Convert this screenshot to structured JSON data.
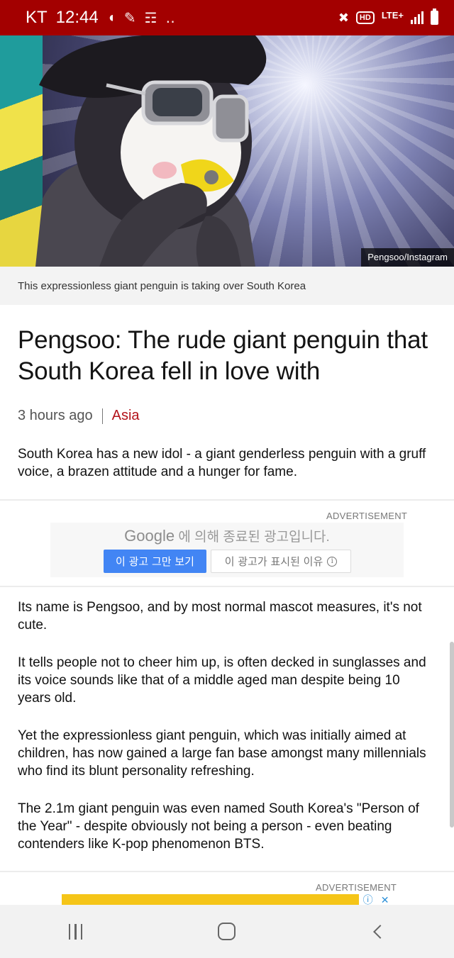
{
  "status_bar": {
    "carrier": "KT",
    "time": "12:44",
    "left_icons": [
      "c-icon",
      "pen-icon",
      "chart-search-icon",
      "more-dots-icon"
    ],
    "hd": "HD",
    "network": "LTE+"
  },
  "hero": {
    "photo_credit": "Pengsoo/Instagram",
    "caption": "This expressionless giant penguin is taking over South Korea"
  },
  "article": {
    "headline": "Pengsoo: The rude giant penguin that South Korea fell in love with",
    "time_ago": "3 hours ago",
    "section": "Asia",
    "summary": "South Korea has a new idol - a giant genderless penguin with a gruff voice, a brazen attitude and a hunger for fame.",
    "paragraphs": [
      "Its name is Pengsoo, and by most normal mascot measures, it's not cute.",
      "It tells people not to cheer him up, is often decked in sunglasses and its voice sounds like that of a middle aged man despite being 10 years old.",
      "Yet the expressionless giant penguin, which was initially aimed at children, has now gained a large fan base amongst many millennials who find its blunt personality refreshing.",
      "The 2.1m giant penguin was even named South Korea's \"Person of the Year\" - despite obviously not being a person - even beating contenders like K-pop phenomenon BTS."
    ]
  },
  "ad1": {
    "label": "ADVERTISEMENT",
    "google": "Google",
    "ended_text": "에 의해 종료된 광고입니다.",
    "stop_button": "이 광고 그만 보기",
    "why_button": "이 광고가 표시된 이유"
  },
  "ad2": {
    "label": "ADVERTISEMENT"
  },
  "colors": {
    "status_bar": "#a30000",
    "section_link": "#b3131b",
    "google_button": "#4285f4",
    "ad_banner": "#f5c518"
  }
}
